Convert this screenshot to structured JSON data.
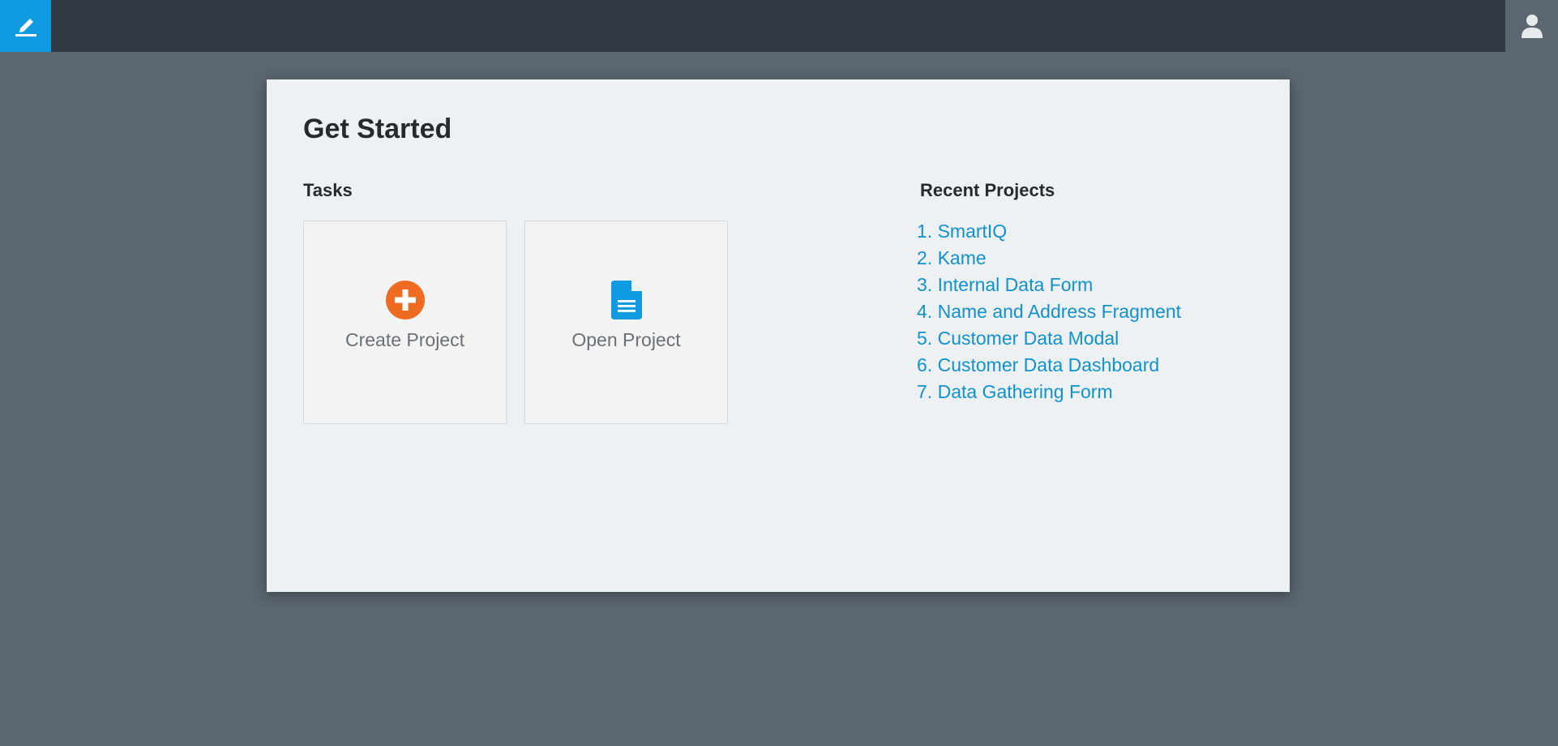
{
  "header": {
    "logo_icon": "pencil-icon",
    "user_icon": "user-icon",
    "accent_color": "#0e9be1"
  },
  "main": {
    "title": "Get Started",
    "tasks": {
      "heading": "Tasks",
      "items": [
        {
          "label": "Create Project",
          "icon": "plus-circle-icon",
          "icon_color": "#ef6b22"
        },
        {
          "label": "Open Project",
          "icon": "document-icon",
          "icon_color": "#0e9be1"
        }
      ]
    },
    "recent": {
      "heading": "Recent Projects",
      "items": [
        {
          "number": "1.",
          "label": "SmartIQ"
        },
        {
          "number": "2.",
          "label": "Kame"
        },
        {
          "number": "3.",
          "label": "Internal Data Form"
        },
        {
          "number": "4.",
          "label": "Name and Address Fragment"
        },
        {
          "number": "5.",
          "label": "Customer Data Modal"
        },
        {
          "number": "6.",
          "label": "Customer Data Dashboard"
        },
        {
          "number": "7.",
          "label": "Data Gathering Form"
        }
      ]
    }
  }
}
